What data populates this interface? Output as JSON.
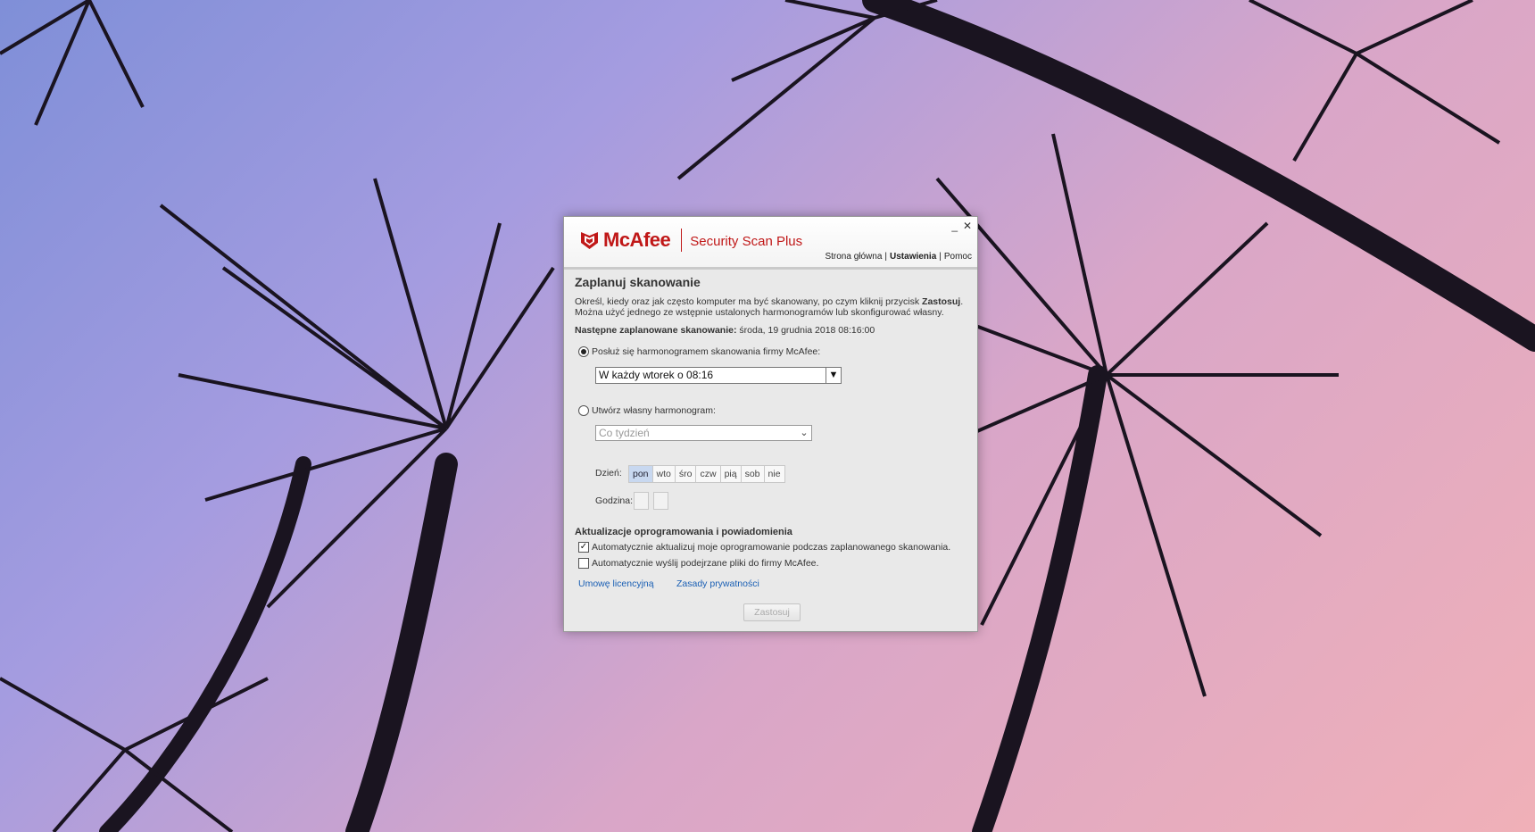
{
  "window": {
    "brand": "McAfee",
    "product": "Security Scan Plus",
    "minimize_glyph": "_",
    "close_glyph": "✕",
    "nav": [
      {
        "label": "Strona główna"
      },
      {
        "label": "Ustawienia"
      },
      {
        "label": "Pomoc"
      }
    ]
  },
  "schedule": {
    "title": "Zaplanuj skanowanie",
    "desc_1": "Określ, kiedy oraz jak często komputer ma być skanowany, po czym kliknij przycisk",
    "desc_bold": "Zastosuj",
    "desc_2": ". Można użyć jednego ze wstępnie ustalonych harmonogramów lub skonfigurować własny.",
    "next_label": "Następne zaplanowane skanowanie:",
    "next_value": "środa, 19 grudnia 2018 08:16:00",
    "mcafee_option": "Posłuż się harmonogramem skanowania firmy McAfee:",
    "mcafee_select": "W każdy wtorek o 08:16",
    "custom_option": "Utwórz własny harmonogram:",
    "custom_select": "Co tydzień",
    "day_label": "Dzień:",
    "days": [
      "pon",
      "wto",
      "śro",
      "czw",
      "pią",
      "sob",
      "nie"
    ],
    "selected_day": "pon",
    "time_label": "Godzina:"
  },
  "updates": {
    "title": "Aktualizacje oprogramowania i powiadomienia",
    "auto_update": "Automatycznie aktualizuj moje oprogramowanie podczas zaplanowanego skanowania.",
    "auto_update_checked": true,
    "auto_send": "Automatycznie wyślij podejrzane pliki do firmy McAfee.",
    "auto_send_checked": false
  },
  "links": {
    "license": "Umowę licencyjną",
    "privacy": "Zasady prywatności"
  },
  "apply_label": "Zastosuj",
  "colors": {
    "brand_red": "#c01818",
    "link_blue": "#1a5fb4",
    "selected_day_bg": "#c8d8f0"
  }
}
